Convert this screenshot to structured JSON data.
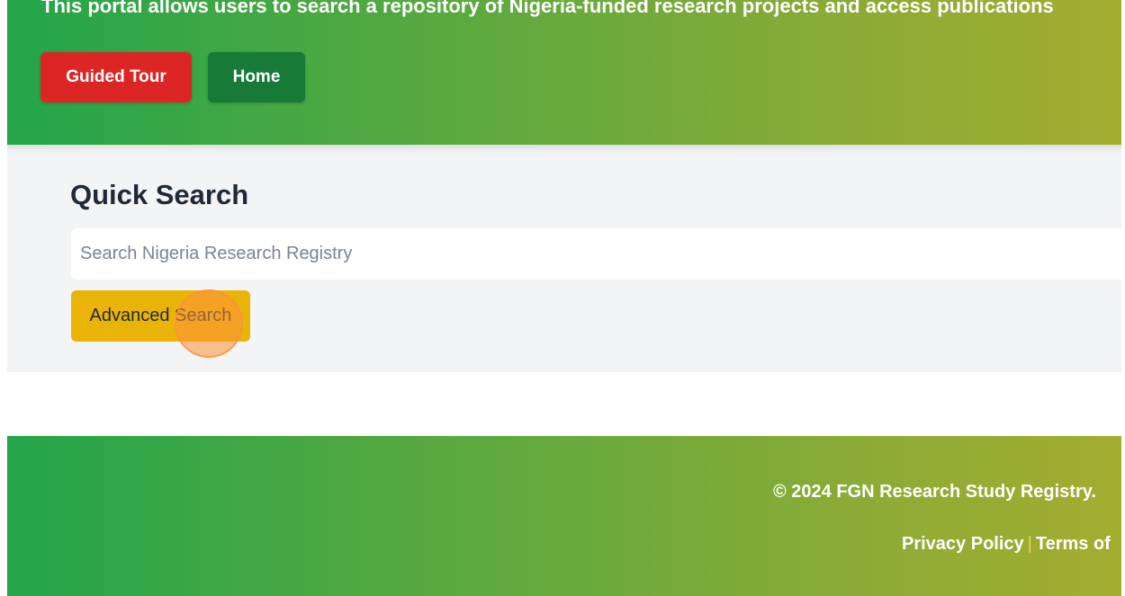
{
  "header": {
    "description": "This portal allows users to search a repository of Nigeria-funded research projects and access publications",
    "guided_tour_label": "Guided Tour",
    "home_label": "Home"
  },
  "search": {
    "title": "Quick Search",
    "placeholder": "Search Nigeria Research Registry",
    "value": "",
    "advanced_label": "Advanced Search"
  },
  "footer": {
    "copyright": "© 2024 FGN Research Study Registry.",
    "privacy_label": "Privacy Policy",
    "separator": "|",
    "terms_label": "Terms of"
  },
  "colors": {
    "gradient_start": "#23a54a",
    "gradient_end": "#a3ad30",
    "tour_button": "#dc2626",
    "home_button": "#177a37",
    "advanced_button": "#eab308",
    "click_indicator": "#fb923c"
  }
}
